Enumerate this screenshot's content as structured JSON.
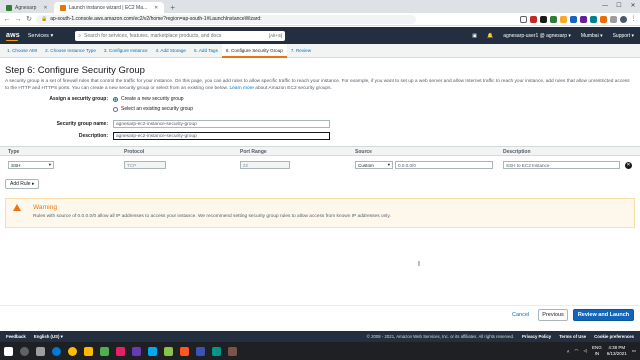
{
  "browser": {
    "tabs": [
      {
        "label": "Agnesarp",
        "active": false
      },
      {
        "label": "Launch instance wizard | EC2 Ma...",
        "active": true
      }
    ],
    "new_tab": "+",
    "url": "ap-south-1.console.aws.amazon.com/ec2/v2/home?region=ap-south-1#LaunchInstanceWizard:"
  },
  "aws_nav": {
    "logo": "aws",
    "services": "Services ▾",
    "search_placeholder": "Search for services, features, marketplace products, and docs",
    "search_shortcut": "[Alt+S]",
    "user": "agnesarp-user1 @ agnesarp ▾",
    "region": "Mumbai ▾",
    "support": "Support ▾"
  },
  "wizard_steps": [
    {
      "label": "1. Choose AMI",
      "active": false
    },
    {
      "label": "2. Choose Instance Type",
      "active": false
    },
    {
      "label": "3. Configure Instance",
      "active": false
    },
    {
      "label": "4. Add Storage",
      "active": false
    },
    {
      "label": "5. Add Tags",
      "active": false
    },
    {
      "label": "6. Configure Security Group",
      "active": true
    },
    {
      "label": "7. Review",
      "active": false
    }
  ],
  "page": {
    "title": "Step 6: Configure Security Group",
    "description": "A security group is a set of firewall rules that control the traffic for your instance. On this page, you can add rules to allow specific traffic to reach your instance. For example, if you want to set up a web server and allow Internet traffic to reach your instance, add rules that allow unrestricted access to the HTTP and HTTPS ports. You can create a new security group or select from an existing one below.",
    "learn_more": "Learn more",
    "learn_more_suffix": " about Amazon EC2 security groups."
  },
  "form": {
    "assign_label": "Assign a security group:",
    "option_new": "Create a new security group",
    "option_existing": "Select an existing security group",
    "name_label": "Security group name:",
    "name_value": "agnesarp-ec2-instance-security-group",
    "description_label": "Description:",
    "description_value": "agnesarp-ec2-instance-security-group"
  },
  "rules_table": {
    "headers": [
      "Type",
      "Protocol",
      "Port Range",
      "Source",
      "Description"
    ],
    "rows": [
      {
        "type": "SSH",
        "protocol": "TCP",
        "port_range": "22",
        "source_mode": "Custom",
        "source": "0.0.0.0/0",
        "description": "SSH to EC2 Instance"
      }
    ],
    "add_rule": "Add Rule ▸"
  },
  "warning": {
    "title": "Warning",
    "text": "Rules with source of 0.0.0.0/0 allow all IP addresses to access your instance. We recommend setting security group rules to allow access from known IP addresses only."
  },
  "footer_buttons": {
    "cancel": "Cancel",
    "previous": "Previous",
    "review": "Review and Launch"
  },
  "console_footer": {
    "feedback": "Feedback",
    "language": "English (US) ▾",
    "copyright": "© 2008 - 2021, Amazon Web Services, Inc. or its affiliates. All rights reserved.",
    "privacy": "Privacy Policy",
    "terms": "Terms of Use",
    "cookies": "Cookie preferences"
  },
  "taskbar": {
    "lang": "ENG",
    "lang2": "IN",
    "time": "4:38 PM",
    "date": "6/13/2021"
  },
  "colors": {
    "aws_nav": "#232f3e",
    "aws_orange": "#ff9900",
    "link_blue": "#0073bb",
    "primary_button": "#1166bb",
    "warning_orange": "#ec7211"
  }
}
